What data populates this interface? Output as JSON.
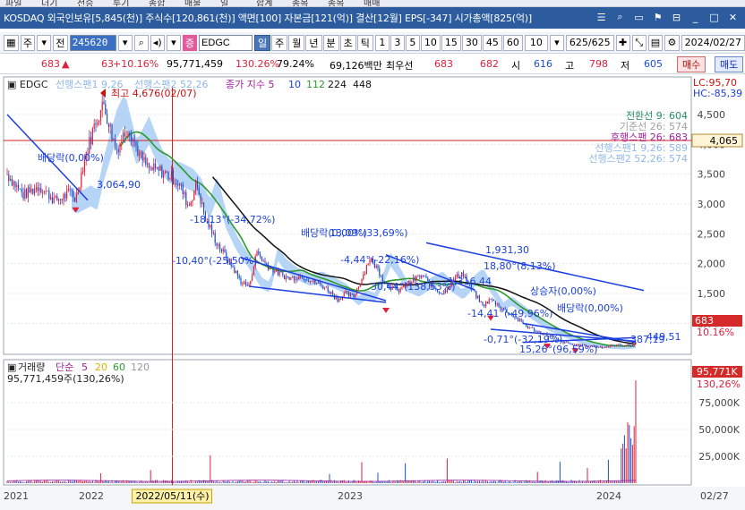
{
  "menu": {
    "items": [
      "파일",
      "더기",
      "전승",
      "투기",
      "종합",
      "매물",
      "일",
      "합계",
      "종목",
      "종목",
      "매매"
    ]
  },
  "title": {
    "text": "KOSDAQ 외국인보유[5,845(천)] 주식수[120,861(천)] 액면[100] 자본금[121(억)] 결산[12월] EPS[-347] 시가총액[825(억)]",
    "icons": [
      "list-icon",
      "find-icon",
      "window-icon",
      "pin-icon",
      "link-icon",
      "minimize-icon",
      "maximize-icon",
      "close-icon"
    ]
  },
  "toolbar": {
    "market_select": "주",
    "prev_label": "전",
    "code": "245620",
    "stock_name": "EDGC",
    "badge": "증",
    "periods": [
      "일",
      "주",
      "월",
      "년",
      "분",
      "초",
      "틱"
    ],
    "active_period": "일",
    "intervals": [
      "1",
      "3",
      "5",
      "10",
      "15",
      "30",
      "45",
      "60"
    ],
    "interval_value": "10",
    "count": "625",
    "count_total": "/625",
    "date": "2024/02/27"
  },
  "quote": {
    "price": "683",
    "change_arrow": "▲",
    "change": "63",
    "change_pct": "+10.16%",
    "volume": "95,771,459",
    "volume_ratio": "130.26%",
    "turnover": "79.24%",
    "amount": "69,126백만",
    "best_bid_label": "최우선",
    "best_ask": "683",
    "best_bid": "682",
    "open_label": "시",
    "open": "616",
    "high_label": "고",
    "high": "798",
    "low_label": "저",
    "low": "605",
    "buy_label": "매수",
    "sell_label": "매도"
  },
  "price_chart": {
    "legend_name": "EDGC",
    "legend_span1": "선행스팬1 9,26",
    "legend_span2": "선행스팬2 52,26",
    "legend_ma": "종가 지수 5",
    "ma_periods": [
      "10",
      "112",
      "224",
      "448"
    ],
    "lc_label": "LC:95,70",
    "hc_label": "HC:-85,39",
    "y_ticks": [
      "4,500",
      "4,000",
      "3,500",
      "3,000",
      "2,500",
      "2,000",
      "1,500",
      "1,000"
    ],
    "ref_price": "4,065",
    "current_price": "683",
    "current_pct": "10.16%",
    "ichimoku_legend": [
      "전환선 9: 604",
      "기준선 26: 574",
      "후행스팬 26: 683",
      "선행스팬1 9,26: 589",
      "선행스팬2 52,26: 574"
    ],
    "annotations": {
      "high": "최고 4,676(02/07)",
      "low1": "3,064,90",
      "div1": "배당락(0,00%)",
      "a1": "-18,13°(-34,72%)",
      "a2": "-10,40°(-25,50%)",
      "a3": "배당락(0,00%)",
      "a4": "13,09°(33,69%)",
      "a5": "-4,44°(-22,16%)",
      "a6": "30,44°(138,53%)",
      "a7": "1,931,30",
      "a8": "18,80°(8,13%)",
      "a9": "-1,316,44",
      "a10": "상승자(0,00%)",
      "a11": "-14,41°(-49,96%)",
      "a12": "배당락(0,00%)",
      "a13": "-0,71°(-32,19%)",
      "a14": "15,26°(96,59%)",
      "a15": "387,19",
      "a16": "449,51"
    }
  },
  "volume_chart": {
    "legend_title": "거래량",
    "legend_mode": "단순",
    "ma_periods": [
      "5",
      "20",
      "60",
      "120"
    ],
    "legend_value": "95,771,459주(130,26%)",
    "y_ticks": [
      "75,000K",
      "50,000K",
      "25,000K"
    ],
    "current_value": "95,771K",
    "current_pct": "130,26%"
  },
  "x_axis": {
    "labels": [
      "2021",
      "2022",
      "2023",
      "2024"
    ],
    "cursor_date": "2022/05/11(수)",
    "end_date": "02/27"
  },
  "colors": {
    "title_bg": "#2c5c9e",
    "candle_up": "#e0203b",
    "candle_down": "#1b4fcf",
    "cloud": "#a9cdf5",
    "ma_green": "#2a9a2a",
    "ma_black": "#111111",
    "trend": "#1b3fe0",
    "ref_line": "#cc2222"
  }
}
